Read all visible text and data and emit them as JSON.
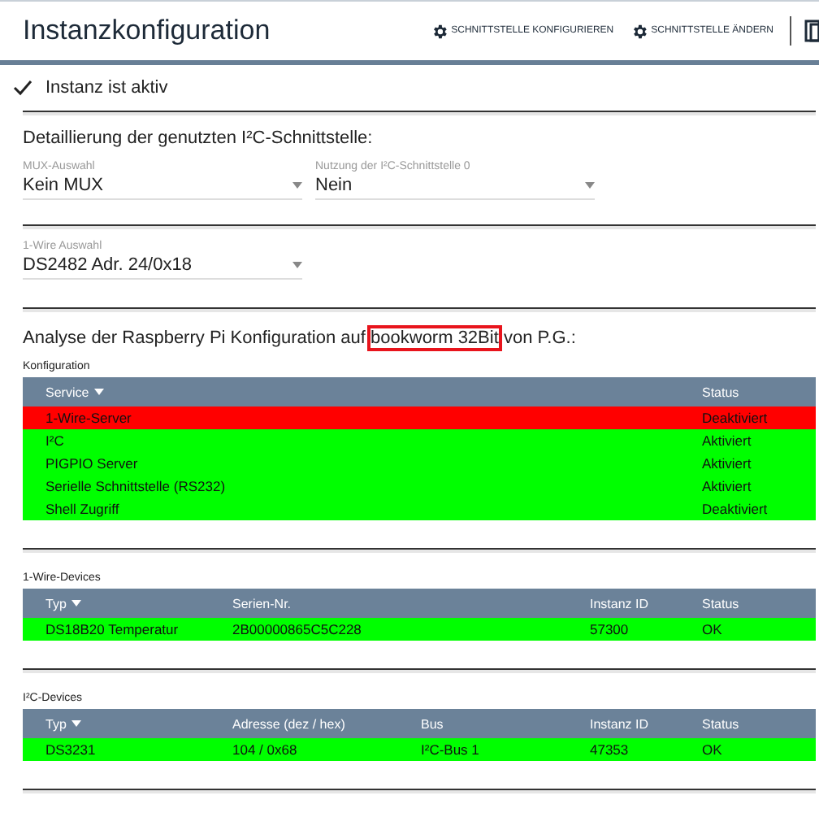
{
  "header": {
    "title": "Instanzkonfiguration",
    "actions": [
      {
        "label": "SCHNITTSTELLE KONFIGURIEREN"
      },
      {
        "label": "SCHNITTSTELLE ÄNDERN"
      }
    ]
  },
  "active": {
    "checked": true,
    "label": "Instanz ist aktiv"
  },
  "i2c_section": {
    "heading": "Detaillierung der genutzten I²C-Schnittstelle:",
    "selects": [
      {
        "label": "MUX-Auswahl",
        "value": "Kein MUX"
      },
      {
        "label": "Nutzung der I²C-Schnittstelle 0",
        "value": "Nein"
      }
    ]
  },
  "onewire_select": {
    "label": "1-Wire Auswahl",
    "value": "DS2482 Adr. 24/0x18"
  },
  "analysis": {
    "before": "Analyse der Raspberry Pi Konfiguration auf",
    "highlight": "bookworm 32Bit",
    "after": "von P.G.:"
  },
  "tables": [
    {
      "title": "Konfiguration",
      "columns": [
        {
          "label": "Service",
          "sorted": true
        },
        {
          "label": "Status",
          "sorted": false
        }
      ],
      "rows": [
        {
          "color": "#ff0000",
          "cells": [
            "1-Wire-Server",
            "Deaktiviert"
          ]
        },
        {
          "color": "#00ff00",
          "cells": [
            "I²C",
            "Aktiviert"
          ]
        },
        {
          "color": "#00ff00",
          "cells": [
            "PIGPIO Server",
            "Aktiviert"
          ]
        },
        {
          "color": "#00ff00",
          "cells": [
            "Serielle Schnittstelle (RS232)",
            "Aktiviert"
          ]
        },
        {
          "color": "#00ff00",
          "cells": [
            "Shell Zugriff",
            "Deaktiviert"
          ]
        }
      ]
    },
    {
      "title": "1-Wire-Devices",
      "columns": [
        {
          "label": "Typ",
          "sorted": true
        },
        {
          "label": "Serien-Nr.",
          "sorted": false
        },
        {
          "label": "Instanz ID",
          "sorted": false
        },
        {
          "label": "Status",
          "sorted": false
        }
      ],
      "rows": [
        {
          "color": "#00ff00",
          "cells": [
            "DS18B20 Temperatur",
            "2B00000865C5C228",
            "57300",
            "OK"
          ]
        }
      ]
    },
    {
      "title": "I²C-Devices",
      "columns": [
        {
          "label": "Typ",
          "sorted": true
        },
        {
          "label": "Adresse (dez / hex)",
          "sorted": false
        },
        {
          "label": "Bus",
          "sorted": false
        },
        {
          "label": "Instanz ID",
          "sorted": false
        },
        {
          "label": "Status",
          "sorted": false
        }
      ],
      "rows": [
        {
          "color": "#00ff00",
          "cells": [
            "DS3231",
            "104 / 0x68",
            "I²C-Bus 1",
            "47353",
            "OK"
          ]
        }
      ]
    }
  ]
}
